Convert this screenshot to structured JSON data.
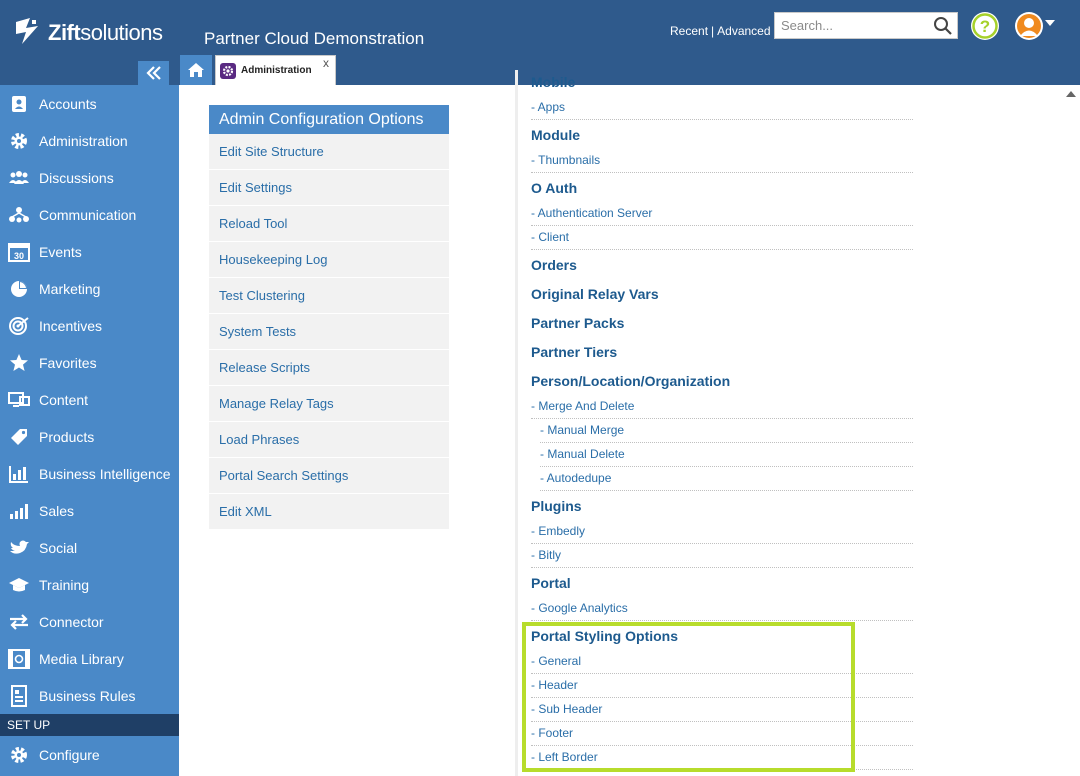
{
  "header": {
    "logo_text_bold": "Zift",
    "logo_text_rest": "solutions",
    "app_title": "Partner Cloud Demonstration",
    "recent_label": "Recent",
    "separator": "|",
    "advanced_label": "Advanced",
    "search_placeholder": "Search...",
    "help_icon": "question-circle-icon",
    "avatar_icon": "user-avatar-icon"
  },
  "tabs": {
    "home_icon": "home-icon",
    "active_tab_label": "Administration",
    "close_label": "x"
  },
  "sidebar": {
    "items": [
      {
        "label": "Accounts",
        "icon": "contacts-icon"
      },
      {
        "label": "Administration",
        "icon": "gear-icon"
      },
      {
        "label": "Discussions",
        "icon": "people-icon"
      },
      {
        "label": "Communication",
        "icon": "network-icon"
      },
      {
        "label": "Events",
        "icon": "calendar-icon"
      },
      {
        "label": "Marketing",
        "icon": "pie-icon"
      },
      {
        "label": "Incentives",
        "icon": "target-icon"
      },
      {
        "label": "Favorites",
        "icon": "star-icon"
      },
      {
        "label": "Content",
        "icon": "monitor-icon"
      },
      {
        "label": "Products",
        "icon": "tag-icon"
      },
      {
        "label": "Business Intelligence",
        "icon": "grid-chart-icon"
      },
      {
        "label": "Sales",
        "icon": "bar-chart-icon"
      },
      {
        "label": "Social",
        "icon": "bird-icon"
      },
      {
        "label": "Training",
        "icon": "graduation-cap-icon"
      },
      {
        "label": "Connector",
        "icon": "arrows-icon"
      },
      {
        "label": "Media Library",
        "icon": "film-icon"
      },
      {
        "label": "Business Rules",
        "icon": "document-icon"
      }
    ],
    "setup_label": "SET UP",
    "configure_label": "Configure",
    "configure_icon": "gear-icon"
  },
  "admin_panel": {
    "title": "Admin Configuration Options",
    "items": [
      "Edit Site Structure",
      "Edit Settings",
      "Reload Tool",
      "Housekeeping Log",
      "Test Clustering",
      "System Tests",
      "Release Scripts",
      "Manage Relay Tags",
      "Load Phrases",
      "Portal Search Settings",
      "Edit XML"
    ]
  },
  "config_list": {
    "mobile": "Mobile",
    "apps": "- Apps",
    "module": "Module",
    "thumbnails": "- Thumbnails",
    "oauth": "O Auth",
    "auth_server": "- Authentication Server",
    "client": "- Client",
    "orders": "Orders",
    "original_relay_vars": "Original Relay Vars",
    "partner_packs": "Partner Packs",
    "partner_tiers": "Partner Tiers",
    "person_location_org": "Person/Location/Organization",
    "merge_and_delete": "- Merge And Delete",
    "manual_merge": "- Manual Merge",
    "manual_delete": "- Manual Delete",
    "autodedupe": "- Autodedupe",
    "plugins": "Plugins",
    "embedly": "- Embedly",
    "bitly": "- Bitly",
    "portal": "Portal",
    "google_analytics": "- Google Analytics",
    "portal_styling_options": "Portal Styling Options",
    "general": "- General",
    "header": "- Header",
    "sub_header": "- Sub Header",
    "footer": "- Footer",
    "left_border": "- Left Border"
  },
  "colors": {
    "topbar": "#2f5a8c",
    "sidebar": "#4a89c8",
    "highlight": "#b7dc2c",
    "link": "#2a6ea8"
  }
}
